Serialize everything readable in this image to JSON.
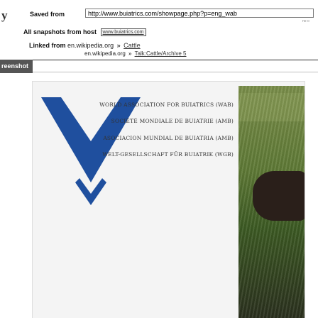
{
  "header": {
    "logo_fragment": "y",
    "saved_from_label": "Saved from",
    "saved_url": "http://www.buiatrics.com/showpage.php?p=eng_wab",
    "corner_tiny": "no o",
    "all_snapshots_label": "All snapshots",
    "from_host_text": "from host",
    "host": "www.buiatrics.com",
    "linked_from_label": "Linked from",
    "link1_host": "en.wikipedia.org",
    "link1_page": "Cattle",
    "link2_host": "en.wikipedia.org",
    "link2_page": "Talk:Cattle/Archive 5",
    "separator": "»"
  },
  "tabs": {
    "screenshot": "reenshot"
  },
  "page": {
    "orgs": [
      "WORLD ASSOCIATION FOR BUIATRICS (WAB)",
      "SOCIÉTÉ MONDIALE DE BUIATRIE (AMB)",
      "ASOCIACION MUNDIAL DE BUIATRIA (AMB)",
      "WELT-GESELLSCHAFT FÜR BUIATRIK (WGB)"
    ],
    "accent_color": "#1f4f9e"
  },
  "icons": {
    "logo_chevron": "chevron-icon"
  }
}
